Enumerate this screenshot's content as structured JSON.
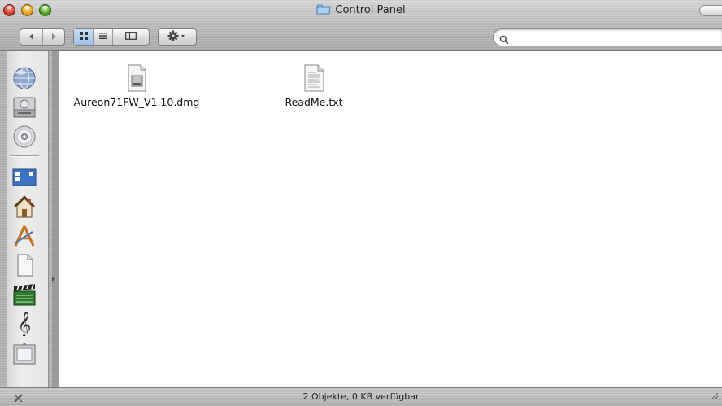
{
  "window": {
    "title": "Control Panel"
  },
  "toolbar": {
    "back_icon": "back-arrow-icon",
    "forward_icon": "forward-arrow-icon",
    "view_icons": [
      "icon-view-icon",
      "list-view-icon",
      "column-view-icon"
    ],
    "action_icon": "gear-icon",
    "search": {
      "value": "",
      "placeholder": ""
    }
  },
  "sidebar": {
    "items": [
      {
        "name": "network",
        "icon": "globe-icon"
      },
      {
        "name": "hard-disk",
        "icon": "hard-drive-icon"
      },
      {
        "name": "cd",
        "icon": "cd-icon"
      },
      {
        "name": "desktop",
        "icon": "desktop-icon"
      },
      {
        "name": "home",
        "icon": "home-icon"
      },
      {
        "name": "applications",
        "icon": "applications-icon"
      },
      {
        "name": "documents",
        "icon": "document-icon"
      },
      {
        "name": "movies",
        "icon": "clapperboard-icon"
      },
      {
        "name": "music",
        "icon": "music-icon"
      },
      {
        "name": "pictures",
        "icon": "picture-frame-icon"
      }
    ]
  },
  "files": [
    {
      "name": "Aureon71FW_V1.10.dmg",
      "icon": "disk-image-icon"
    },
    {
      "name": "ReadMe.txt",
      "icon": "text-document-icon"
    }
  ],
  "statusbar": {
    "text": "2 Objekte, 0 KB verfügbar"
  },
  "colors": {
    "accent": "#9dc1ea",
    "content_bg": "#ffffff",
    "metal": "#b8b8b8"
  }
}
